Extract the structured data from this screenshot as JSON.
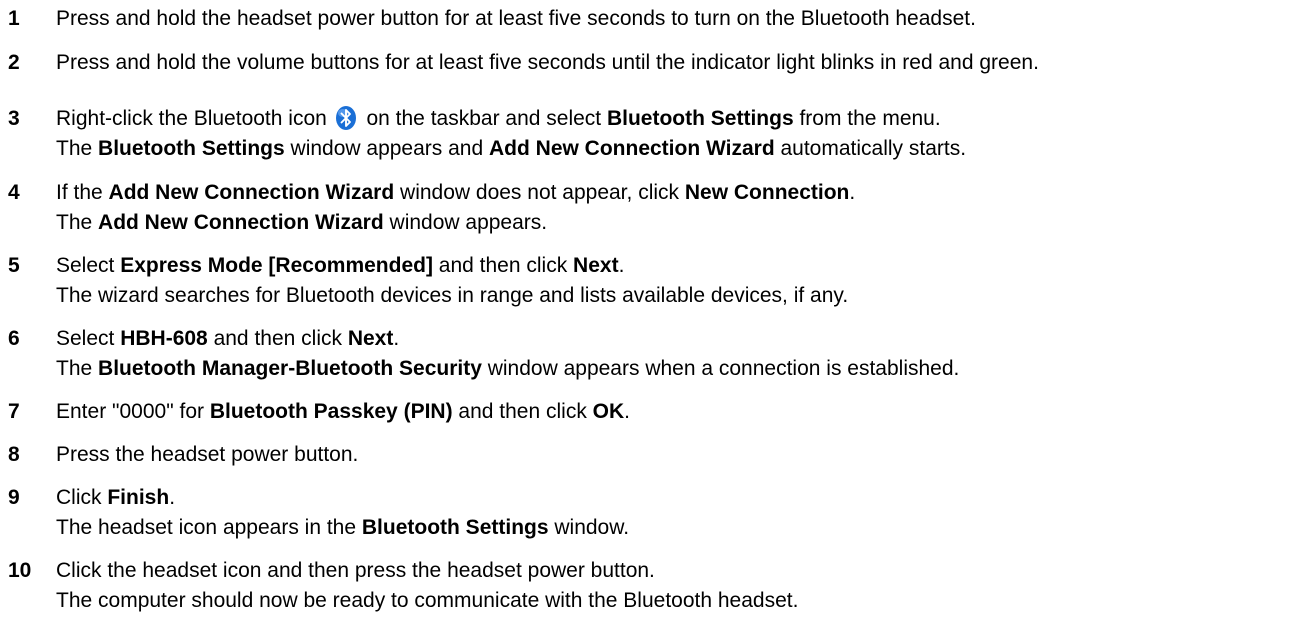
{
  "steps": [
    {
      "number": "1",
      "lines": [
        [
          {
            "t": "Press and hold the headset power button for at least five seconds to turn on the Bluetooth headset."
          }
        ]
      ]
    },
    {
      "number": "2",
      "lines": [
        [
          {
            "t": "Press and hold the volume buttons for at least five seconds until the indicator light blinks in red and green."
          }
        ]
      ]
    },
    {
      "number": "3",
      "lines": [
        [
          {
            "t": "Right-click the Bluetooth icon "
          },
          {
            "icon": "bluetooth-icon"
          },
          {
            "t": " on the taskbar and select "
          },
          {
            "t": "Bluetooth Settings",
            "b": true
          },
          {
            "t": " from the menu."
          }
        ],
        [
          {
            "t": "The "
          },
          {
            "t": "Bluetooth Settings",
            "b": true
          },
          {
            "t": " window appears and "
          },
          {
            "t": "Add New Connection Wizard",
            "b": true
          },
          {
            "t": " automatically starts."
          }
        ]
      ]
    },
    {
      "number": "4",
      "lines": [
        [
          {
            "t": "If the "
          },
          {
            "t": "Add New Connection Wizard",
            "b": true
          },
          {
            "t": " window does not appear, click "
          },
          {
            "t": "New Connection",
            "b": true
          },
          {
            "t": "."
          }
        ],
        [
          {
            "t": "The "
          },
          {
            "t": "Add New Connection Wizard",
            "b": true
          },
          {
            "t": " window appears."
          }
        ]
      ]
    },
    {
      "number": "5",
      "lines": [
        [
          {
            "t": "Select "
          },
          {
            "t": "Express Mode [Recommended]",
            "b": true
          },
          {
            "t": " and then click "
          },
          {
            "t": "Next",
            "b": true
          },
          {
            "t": "."
          }
        ],
        [
          {
            "t": "The wizard searches for Bluetooth devices in range and lists available devices, if any."
          }
        ]
      ]
    },
    {
      "number": "6",
      "lines": [
        [
          {
            "t": "Select "
          },
          {
            "t": "HBH-608",
            "b": true
          },
          {
            "t": " and then click "
          },
          {
            "t": "Next",
            "b": true
          },
          {
            "t": "."
          }
        ],
        [
          {
            "t": "The "
          },
          {
            "t": "Bluetooth Manager-Bluetooth Security",
            "b": true
          },
          {
            "t": " window appears when a connection is established."
          }
        ]
      ]
    },
    {
      "number": "7",
      "lines": [
        [
          {
            "t": "Enter \"0000\" for "
          },
          {
            "t": "Bluetooth Passkey (PIN)",
            "b": true
          },
          {
            "t": " and then click "
          },
          {
            "t": "OK",
            "b": true
          },
          {
            "t": "."
          }
        ]
      ]
    },
    {
      "number": "8",
      "lines": [
        [
          {
            "t": "Press the headset power button."
          }
        ]
      ]
    },
    {
      "number": "9",
      "lines": [
        [
          {
            "t": "Click "
          },
          {
            "t": "Finish",
            "b": true
          },
          {
            "t": "."
          }
        ],
        [
          {
            "t": "The headset icon appears in the "
          },
          {
            "t": "Bluetooth Settings",
            "b": true
          },
          {
            "t": " window."
          }
        ]
      ]
    },
    {
      "number": "10",
      "lines": [
        [
          {
            "t": "Click the headset icon and then press the headset power button."
          }
        ],
        [
          {
            "t": "The computer should now be ready to communicate with the Bluetooth headset."
          }
        ]
      ]
    }
  ],
  "colors": {
    "text": "#000000",
    "background": "#ffffff",
    "bluetooth_icon_blue": "#1a6fd6"
  }
}
